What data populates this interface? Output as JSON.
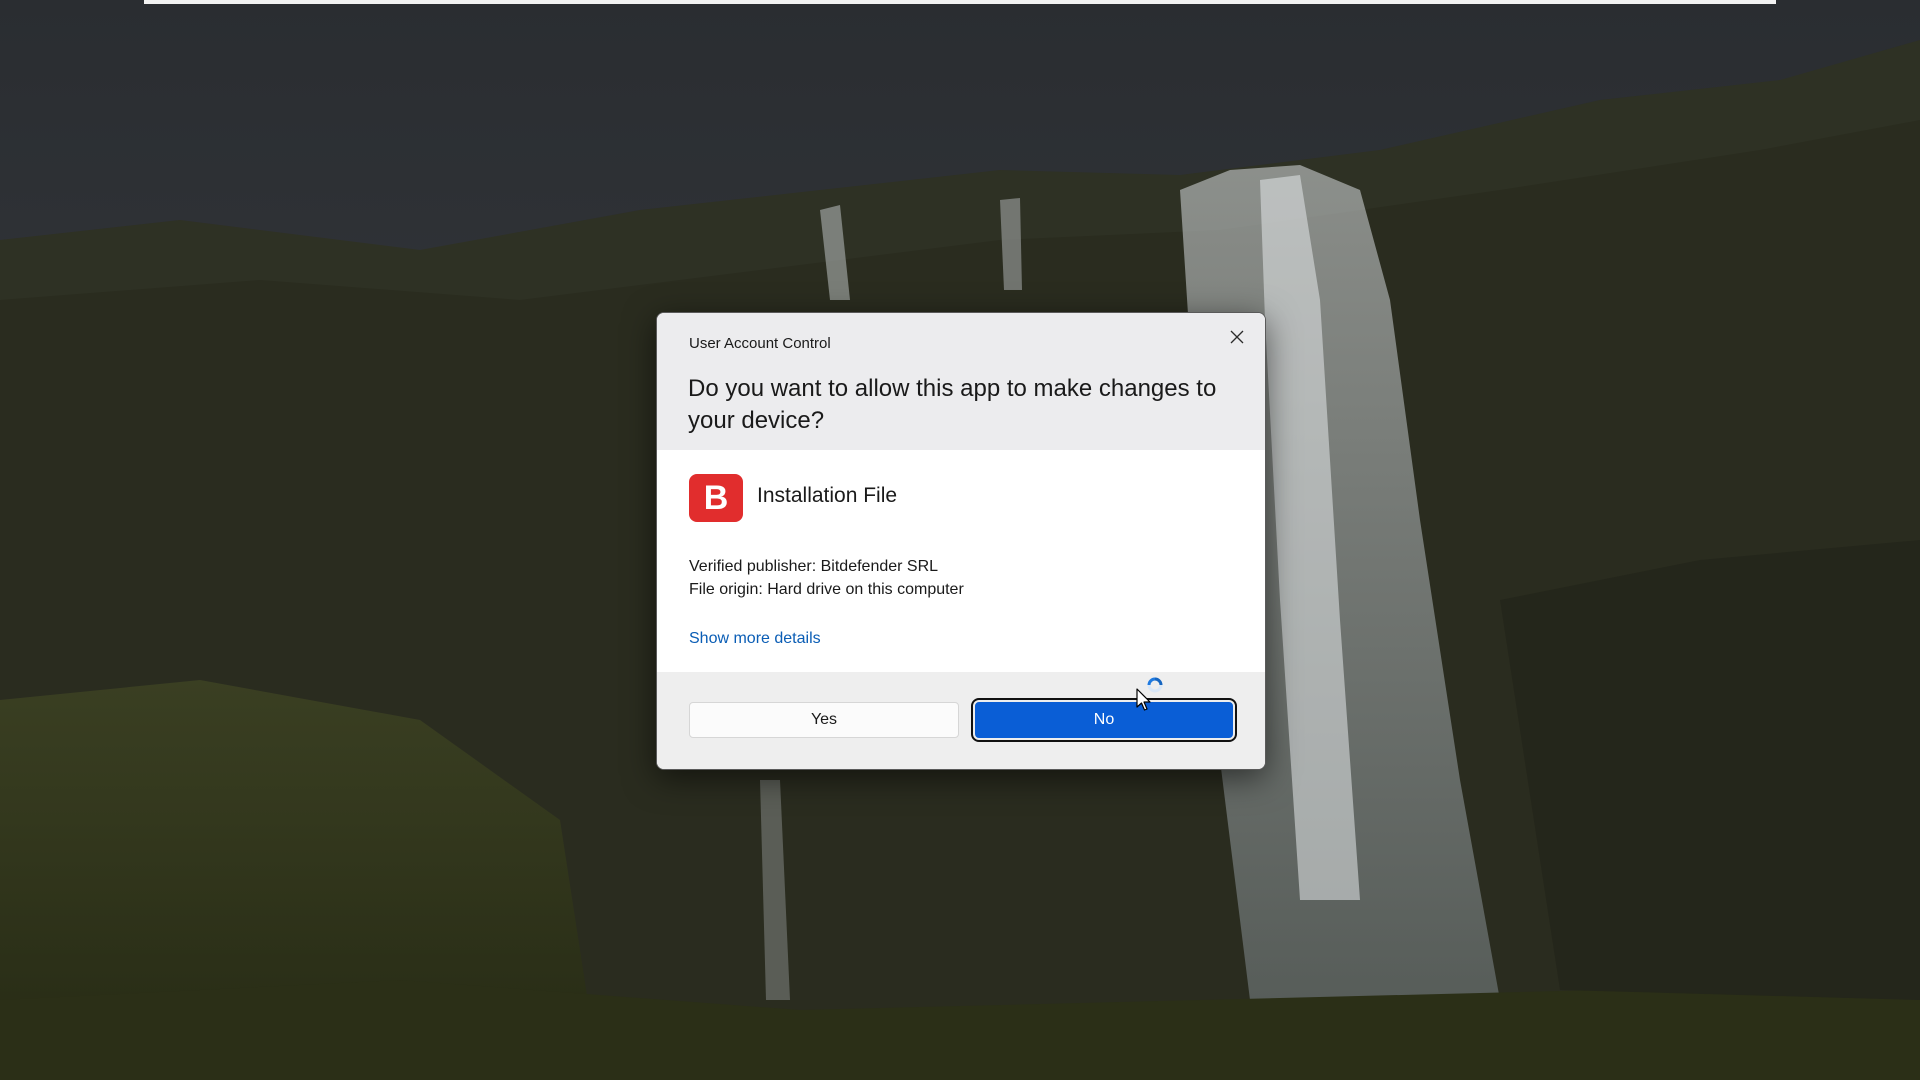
{
  "dialog": {
    "title": "User Account Control",
    "question": "Do you want to allow this app to make changes to your device?",
    "close_icon": "close-icon",
    "app": {
      "icon_letter": "B",
      "icon_color": "#e12d2d",
      "name": "Installation File"
    },
    "publisher": "Verified publisher: Bitdefender SRL",
    "origin": "File origin: Hard drive on this computer",
    "more_details": "Show more details",
    "buttons": {
      "yes": "Yes",
      "no": "No"
    }
  },
  "colors": {
    "accent": "#0a5ed6",
    "link": "#0a5db5",
    "header_bg": "#ececee"
  },
  "cursor": {
    "state": "busy",
    "icon": "busy-pointer-icon"
  }
}
